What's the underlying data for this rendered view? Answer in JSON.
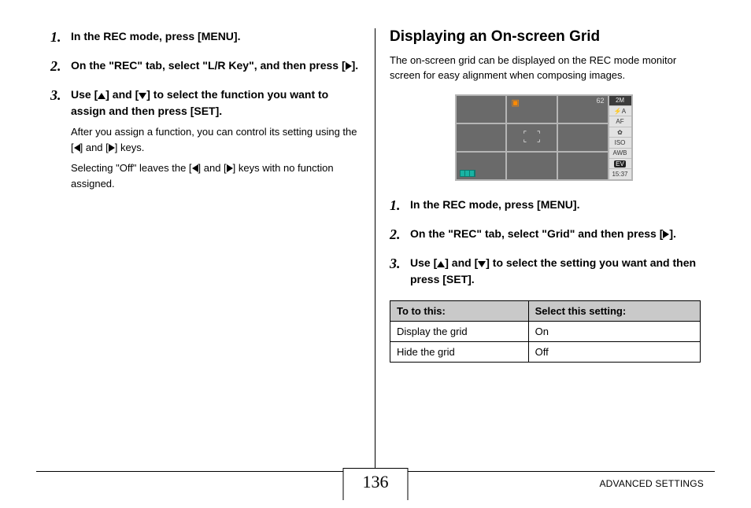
{
  "left": {
    "steps": [
      {
        "text_a": "In the REC mode, press [MENU]."
      },
      {
        "text_a": "On the \"REC\" tab, select \"L/R Key\", and then press [",
        "icon": "right",
        "text_b": "]."
      },
      {
        "text_a": "Use [",
        "icon1": "up",
        "mid": "] and [",
        "icon2": "down",
        "text_b": "] to select the function you want to assign and then press [SET].",
        "sub_a": "After you assign a function, you can control its setting using the [",
        "sub_icon1": "left",
        "sub_mid": "] and [",
        "sub_icon2": "right",
        "sub_b": "] keys.",
        "sub2_a": "Selecting \"Off\" leaves the [",
        "sub2_icon1": "left",
        "sub2_mid": "] and [",
        "sub2_icon2": "right",
        "sub2_b": "] keys with no function assigned."
      }
    ]
  },
  "right": {
    "title": "Displaying an On-screen Grid",
    "lead": "The on-screen grid can be displayed on the REC mode monitor screen for easy alignment when composing images.",
    "illus": {
      "count": "62",
      "sidebar": [
        "2M",
        "⚡A",
        "AF",
        "✿",
        "ISO",
        "AWB",
        "EV",
        "15:37"
      ]
    },
    "steps": [
      {
        "text_a": "In the REC mode, press [MENU]."
      },
      {
        "text_a": "On the \"REC\" tab, select \"Grid\" and then press [",
        "icon": "right",
        "text_b": "]."
      },
      {
        "text_a": "Use [",
        "icon1": "up",
        "mid": "] and [",
        "icon2": "down",
        "text_b": "] to select the setting you want and then press [SET]."
      }
    ],
    "table": {
      "headers": [
        "To to this:",
        "Select this setting:"
      ],
      "rows": [
        [
          "Display the grid",
          "On"
        ],
        [
          "Hide the grid",
          "Off"
        ]
      ]
    }
  },
  "footer": {
    "page": "136",
    "section": "ADVANCED SETTINGS"
  }
}
